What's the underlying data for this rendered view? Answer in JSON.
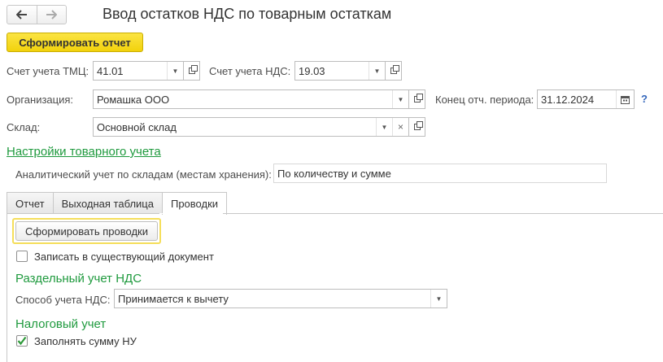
{
  "window": {
    "title": "Ввод остатков НДС по товарным остаткам",
    "nav": {
      "back_icon": "arrow-left-icon",
      "forward_icon": "arrow-right-icon"
    }
  },
  "toolbar": {
    "generate_report_label": "Сформировать отчет"
  },
  "form": {
    "tmc_account": {
      "label": "Счет учета ТМЦ:",
      "value": "41.01"
    },
    "vat_account": {
      "label": "Счет учета НДС:",
      "value": "19.03"
    },
    "organization": {
      "label": "Организация:",
      "value": "Ромашка ООО"
    },
    "period_end": {
      "label": "Конец отч. периода:",
      "value": "31.12.2024",
      "help": "?"
    },
    "warehouse": {
      "label": "Склад:",
      "value": "Основной склад"
    }
  },
  "inventory_settings": {
    "link_label": "Настройки товарного учета",
    "analytic_label": "Аналитический учет по складам (местам хранения):",
    "analytic_value": "По количеству и сумме"
  },
  "tabs": [
    {
      "label": "Отчет",
      "active": false
    },
    {
      "label": "Выходная таблица",
      "active": false
    },
    {
      "label": "Проводки",
      "active": true
    }
  ],
  "postings": {
    "generate_button_label": "Сформировать проводки",
    "write_existing": {
      "label": "Записать в существующий документ",
      "checked": false
    },
    "separate_vat": {
      "heading": "Раздельный учет НДС",
      "method_label": "Способ учета НДС:",
      "method_value": "Принимается к вычету"
    },
    "tax_accounting": {
      "heading": "Налоговый учет",
      "fill_nu": {
        "label": "Заполнять сумму НУ",
        "checked": true
      }
    }
  },
  "colors": {
    "accent_yellow": "#f2d20c",
    "section_green": "#1f9a3e",
    "check_green": "#2e9a3a",
    "help_blue": "#3366bb"
  }
}
